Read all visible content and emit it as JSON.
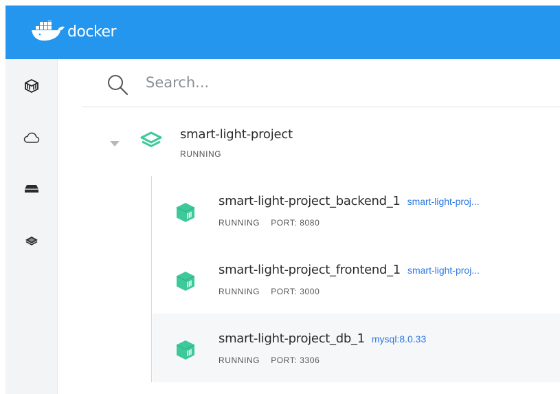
{
  "app": {
    "logo_text": "docker"
  },
  "search": {
    "placeholder": "Search..."
  },
  "sidebar": {
    "items": [
      {
        "name": "containers",
        "icon": "container-box-icon"
      },
      {
        "name": "dev-environments",
        "icon": "cloud-icon"
      },
      {
        "name": "volumes",
        "icon": "disk-icon"
      },
      {
        "name": "images",
        "icon": "layers-icon"
      }
    ]
  },
  "project": {
    "name": "smart-light-project",
    "status": "RUNNING",
    "icon": "stack-layers-icon",
    "containers": [
      {
        "name": "smart-light-project_backend_1",
        "image": "smart-light-proj...",
        "status": "RUNNING",
        "port": "PORT: 8080"
      },
      {
        "name": "smart-light-project_frontend_1",
        "image": "smart-light-proj...",
        "status": "RUNNING",
        "port": "PORT: 3000"
      },
      {
        "name": "smart-light-project_db_1",
        "image": "mysql:8.0.33",
        "status": "RUNNING",
        "port": "PORT: 3306"
      }
    ]
  },
  "colors": {
    "brand": "#2496ed",
    "accent_green": "#3ec99a",
    "link": "#2b78e4",
    "sidebar_bg": "#f3f4f5"
  }
}
